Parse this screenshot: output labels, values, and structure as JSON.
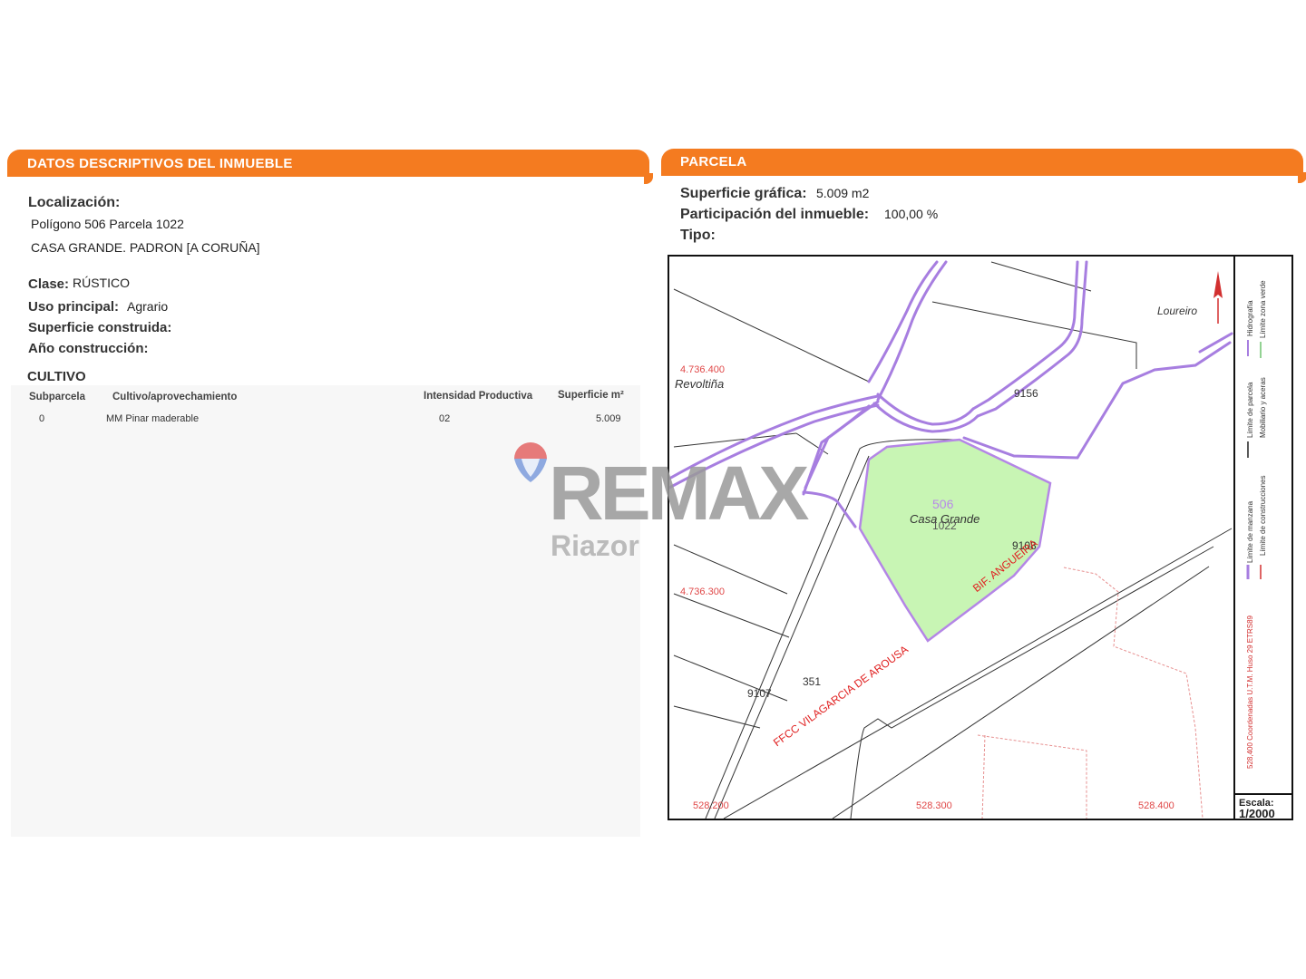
{
  "left_panel": {
    "header": "DATOS DESCRIPTIVOS DEL INMUEBLE",
    "localizacion_label": "Localización:",
    "localizacion_line1": "Polígono 506 Parcela 1022",
    "localizacion_line2": "CASA GRANDE. PADRON [A CORUÑA]",
    "clase_label": "Clase:",
    "clase_value": "RÚSTICO",
    "uso_label": "Uso principal:",
    "uso_value": "Agrario",
    "superficie_label": "Superficie construida:",
    "anio_label": "Año construcción:",
    "cultivo_title": "CULTIVO",
    "cultivo_headers": [
      "Subparcela",
      "Cultivo/aprovechamiento",
      "Intensidad Productiva",
      "Superficie m²"
    ],
    "cultivo_rows": [
      [
        "0",
        "MM Pinar maderable",
        "02",
        "5.009"
      ]
    ]
  },
  "right_panel": {
    "header": "PARCELA",
    "superficie_label": "Superficie gráfica:",
    "superficie_value": "5.009 m2",
    "participacion_label": "Participación del inmueble:",
    "participacion_value": "100,00 %",
    "tipo_label": "Tipo:"
  },
  "map": {
    "coord_y1": "4.736.400",
    "coord_y2": "4.736.300",
    "coord_x1": "528.200",
    "coord_x2": "528.300",
    "coord_x3": "528.400",
    "place_revoltina": "Revoltiña",
    "place_loureiro": "Loureiro",
    "place_casa_grande": "Casa Grande",
    "poligono_number": "506",
    "parcela_number": "1022",
    "parcel_9156": "9156",
    "parcel_9108": "9108",
    "parcel_9107": "9107",
    "parcel_351": "351",
    "rail_label": "FFCC VILAGARCIA DE AROUSA",
    "branch_label": "BIF. ANGUEIRA",
    "legend_hidrografia": "Hidrografía",
    "legend_zona_verde": "Límite zona verde",
    "legend_parcela": "Límite de parcela",
    "legend_mobiliario": "Mobiliario y aceras",
    "legend_manzana": "Límite de manzana",
    "legend_construcciones": "Límite de construcciones",
    "legend_coords": "528,400 Coordenadas U.T.M. Huso 29 ETRS89",
    "escala_label": "Escala:",
    "escala_value": "1/2000",
    "parcel_fill": "#c8f5b4",
    "road_color": "#a77ee0"
  },
  "watermark": {
    "brand": "REMAX",
    "office": "Riazor"
  }
}
